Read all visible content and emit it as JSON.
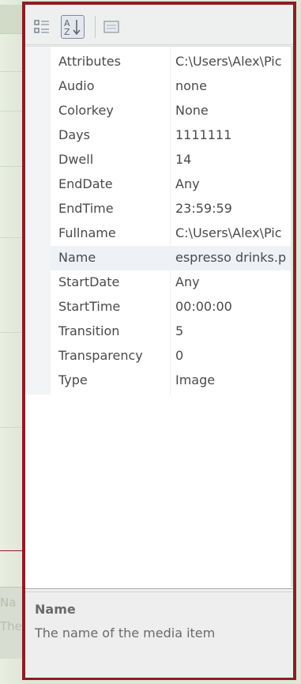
{
  "background": {
    "lower_labels": [
      "Na",
      "The"
    ]
  },
  "toolbar": {
    "categorized_icon": "categorized-icon",
    "alphabetical_icon": "sort-az-icon",
    "pages_icon": "property-pages-icon"
  },
  "properties": [
    {
      "name": "Attributes",
      "value": "C:\\Users\\Alex\\Pic"
    },
    {
      "name": "Audio",
      "value": "none"
    },
    {
      "name": "Colorkey",
      "value": "None"
    },
    {
      "name": "Days",
      "value": "1111111"
    },
    {
      "name": "Dwell",
      "value": "14"
    },
    {
      "name": "EndDate",
      "value": "Any"
    },
    {
      "name": "EndTime",
      "value": "23:59:59"
    },
    {
      "name": "Fullname",
      "value": "C:\\Users\\Alex\\Pic"
    },
    {
      "name": "Name",
      "value": "espresso drinks.p"
    },
    {
      "name": "StartDate",
      "value": "Any"
    },
    {
      "name": "StartTime",
      "value": "00:00:00"
    },
    {
      "name": "Transition",
      "value": "5"
    },
    {
      "name": "Transparency",
      "value": "0"
    },
    {
      "name": "Type",
      "value": "Image"
    }
  ],
  "selected_property": "Name",
  "description": {
    "title": "Name",
    "text": "The name of the media item"
  },
  "colors": {
    "frame": "#8a1f22",
    "selected_row": "#eef1f6"
  }
}
